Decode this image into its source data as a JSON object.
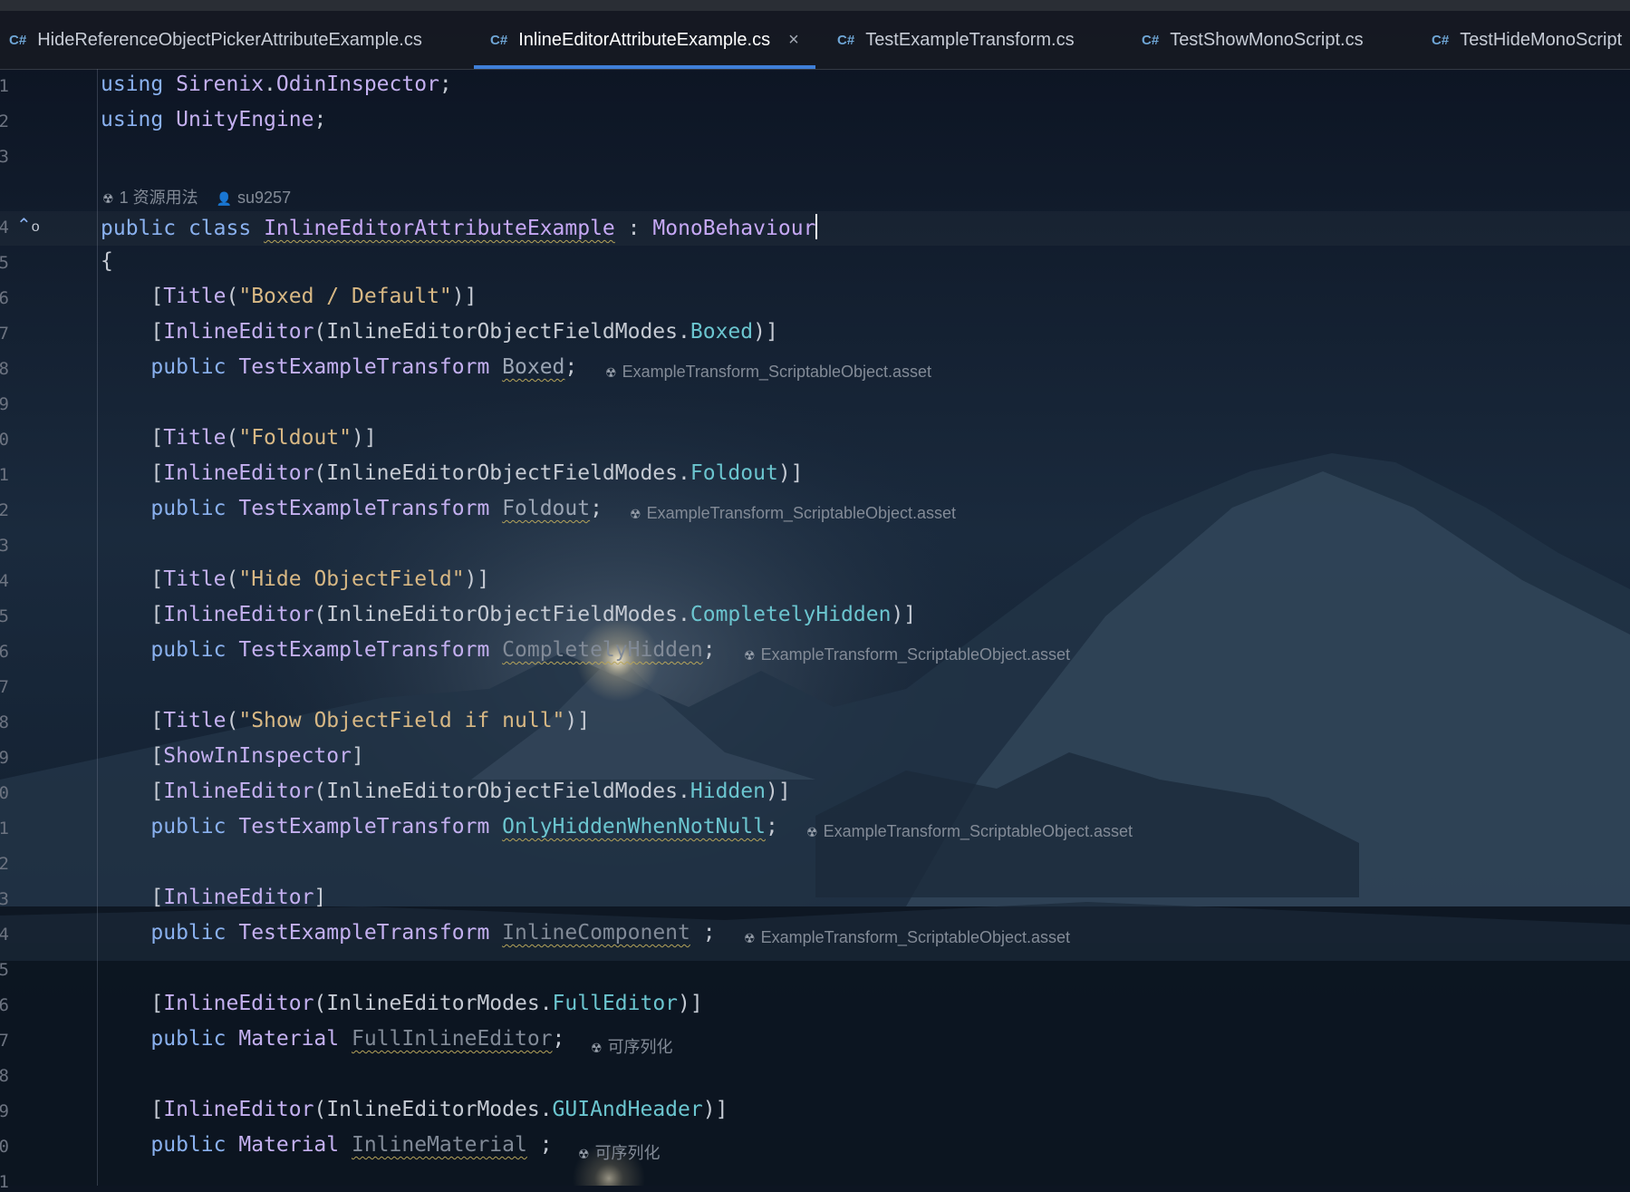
{
  "tabs": [
    {
      "icon": "C#",
      "label": "HideReferenceObjectPickerAttributeExample.cs",
      "active": false
    },
    {
      "icon": "C#",
      "label": "InlineEditorAttributeExample.cs",
      "active": true,
      "close": "×"
    },
    {
      "icon": "C#",
      "label": "TestExampleTransform.cs",
      "active": false
    },
    {
      "icon": "C#",
      "label": "TestShowMonoScript.cs",
      "active": false
    },
    {
      "icon": "C#",
      "label": "TestHideMonoScript",
      "active": false
    }
  ],
  "line_numbers": [
    "1",
    "2",
    "3",
    "4",
    "5",
    "6",
    "7",
    "8",
    "9",
    "0",
    "1",
    "2",
    "3",
    "4",
    "5",
    "6",
    "7",
    "8",
    "9",
    "0",
    "1",
    "2",
    "3",
    "4",
    "5",
    "6",
    "7",
    "8",
    "9",
    "0",
    "1"
  ],
  "code": {
    "using": "using",
    "ns1": "Sirenix",
    "dot": ".",
    "ns1b": "OdinInspector",
    "semi": ";",
    "ns2": "UnityEngine",
    "usages": "1 资源用法",
    "author": "su9257",
    "public": "public",
    "class": "class",
    "class_name": "InlineEditorAttributeExample",
    "colon": ":",
    "base": "MonoBehaviour",
    "open_brace": "{",
    "title": "Title",
    "inline_editor": "InlineEditor",
    "show_in_inspector": "ShowInInspector",
    "obj_modes": "InlineEditorObjectFieldModes",
    "editor_modes": "InlineEditorModes",
    "type_transform": "TestExampleTransform",
    "type_material": "Material",
    "t1": "\"Boxed / Default\"",
    "t2": "\"Foldout\"",
    "t3": "\"Hide ObjectField\"",
    "t4": "\"Show ObjectField if null\"",
    "m_boxed": "Boxed",
    "m_foldout": "Foldout",
    "m_hidden_c": "CompletelyHidden",
    "m_hidden": "Hidden",
    "m_full": "FullEditor",
    "m_gui": "GUIAndHeader",
    "f1": "Boxed",
    "f2": "Foldout",
    "f3": "CompletelyHidden",
    "f4": "OnlyHiddenWhenNotNull",
    "f5": "InlineComponent",
    "f6": "FullInlineEditor",
    "f7": "InlineMaterial",
    "asset_hint": "ExampleTransform_ScriptableObject.asset",
    "serializable_hint": "可序列化"
  },
  "colors": {
    "keyword": "#8ab1ef",
    "type": "#c4b0f0",
    "string": "#d8b884",
    "enum": "#6bc5cf",
    "tab_active": "#3f7fd8"
  }
}
